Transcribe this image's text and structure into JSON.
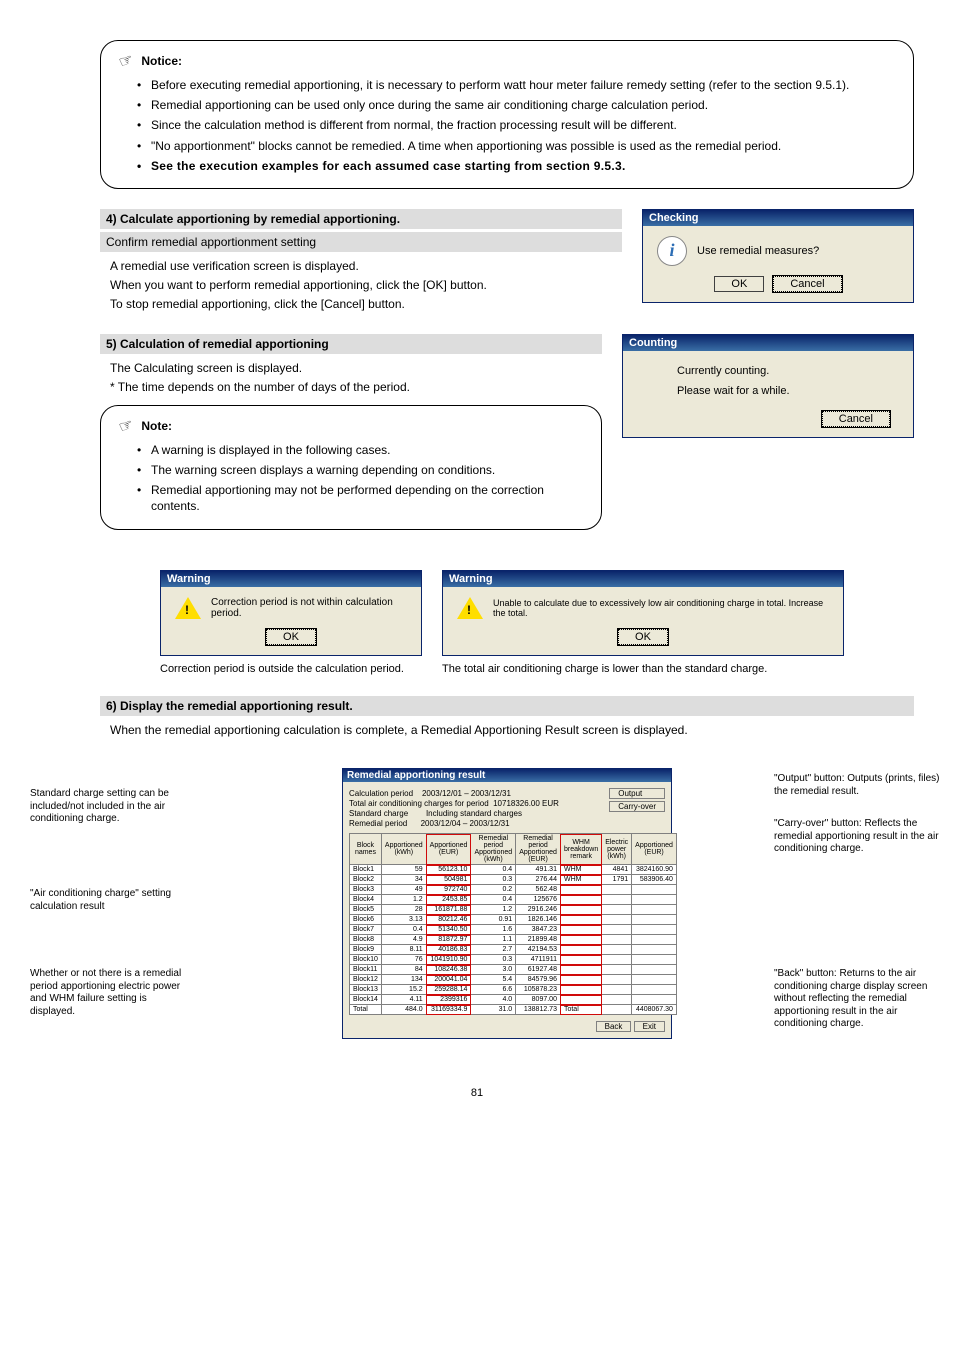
{
  "page_number": "81",
  "notice": {
    "heading": "Notice:",
    "bullets": [
      "Before executing remedial apportioning, it is necessary to perform watt hour meter failure remedy setting (refer to the section 9.5.1).",
      "Remedial apportioning can be used only once during the same air conditioning charge calculation period.",
      "Since the calculation method is different from normal, the fraction processing result will be different.",
      "\"No apportionment\" blocks cannot be remedied. A time when apportioning was possible is used as the remedial period."
    ],
    "bold_line": "See the execution examples for each assumed case starting from section 9.5.3."
  },
  "step4": {
    "header": "4) Calculate apportioning by remedial apportioning.",
    "sub": "Confirm remedial apportionment setting",
    "body": [
      "A remedial use verification screen is displayed.",
      "When you want to perform remedial apportioning, click the [OK] button.",
      "To stop remedial apportioning, click the [Cancel] button."
    ],
    "dlg": {
      "title": "Checking",
      "msg": "Use remedial measures?",
      "ok": "OK",
      "cancel": "Cancel"
    }
  },
  "step5": {
    "header": "5) Calculation of remedial apportioning",
    "body": [
      "The Calculating screen is displayed.",
      "* The time depends on the number of days of the period."
    ],
    "note_heading": "Note:",
    "note_bullets": [
      "A warning is displayed in the following cases.",
      "The warning screen displays a warning depending on conditions.",
      "Remedial apportioning may not be performed depending on the correction contents."
    ],
    "dlg": {
      "title": "Counting",
      "line1": "Currently counting.",
      "line2": "Please wait for a while.",
      "cancel": "Cancel"
    }
  },
  "warnings": {
    "w1": {
      "title": "Warning",
      "msg": "Correction period is not within calculation period.",
      "ok": "OK",
      "cap": "Correction period is outside the calculation period."
    },
    "w2": {
      "title": "Warning",
      "msg": "Unable to calculate due to excessively low air conditioning charge in total. Increase the total.",
      "ok": "OK",
      "cap": "The total air conditioning charge is lower than the standard charge."
    }
  },
  "step6": {
    "header": "6) Display the remedial apportioning result.",
    "body": "When the remedial apportioning calculation is complete, a Remedial Apportioning Result screen is displayed.",
    "annotations": {
      "a1": "Standard charge setting can be included/not included in the air conditioning charge.",
      "a2": "\"Air conditioning charge\" setting calculation result",
      "a3": "Whether or not there is a remedial period apportioning electric power and WHM failure setting is displayed.",
      "a4": "\"Output\" button: Outputs (prints, files) the remedial result.",
      "a5": "\"Carry-over\" button: Reflects the remedial apportioning result in the air conditioning charge.",
      "a6": "\"Back\" button: Returns to the air conditioning charge display screen without reflecting the remedial apportioning result in the air conditioning charge."
    }
  },
  "result_dlg": {
    "title": "Remedial apportioning result",
    "meta": {
      "calc_period_lbl": "Calculation period",
      "calc_period_val": "2003/12/01 – 2003/12/31",
      "total_lbl": "Total air conditioning charges for period",
      "total_val": "10718326.00 EUR",
      "std_lbl": "Standard charge",
      "std_val": "Including standard charges",
      "rem_lbl": "Remedial period",
      "rem_val": "2003/12/04 – 2003/12/31"
    },
    "buttons": {
      "output": "Output",
      "carryover": "Carry-over",
      "back": "Back",
      "exit": "Exit"
    },
    "headers": {
      "block": "Block names",
      "app_kwh": "Apportioned (kWh)",
      "app_eur": "Apportioned (EUR)",
      "rem_kwh": "Remedial period Apportioned (kWh)",
      "rem_eur": "Remedial period Apportioned (EUR)",
      "whm": "WHM breakdown remark",
      "elec_kwh": "Electric power (kWh)",
      "elec_eur": "Apportioned (EUR)"
    },
    "rows": [
      {
        "name": "Block1",
        "a": "59",
        "b": "56123.10",
        "c": "0.4",
        "d": "491.31",
        "whm": "WHM",
        "e": "4841",
        "f": "3824160.90"
      },
      {
        "name": "Block2",
        "a": "34",
        "b": "504981",
        "c": "0.3",
        "d": "276.44",
        "whm": "WHM",
        "e": "1791",
        "f": "583906.40"
      },
      {
        "name": "Block3",
        "a": "49",
        "b": "972740",
        "c": "0.2",
        "d": "562.48",
        "whm": "",
        "e": "",
        "f": ""
      },
      {
        "name": "Block4",
        "a": "1.2",
        "b": "2453.85",
        "c": "0.4",
        "d": "125676",
        "whm": "",
        "e": "",
        "f": ""
      },
      {
        "name": "Block5",
        "a": "28",
        "b": "161871.88",
        "c": "1.2",
        "d": "2916.246",
        "whm": "",
        "e": "",
        "f": ""
      },
      {
        "name": "Block6",
        "a": "3.13",
        "b": "80212.46",
        "c": "0.91",
        "d": "1826.146",
        "whm": "",
        "e": "",
        "f": ""
      },
      {
        "name": "Block7",
        "a": "0.4",
        "b": "51340.50",
        "c": "1.6",
        "d": "3847.23",
        "whm": "",
        "e": "",
        "f": ""
      },
      {
        "name": "Block8",
        "a": "4.9",
        "b": "81872.97",
        "c": "1.1",
        "d": "21899.48",
        "whm": "",
        "e": "",
        "f": ""
      },
      {
        "name": "Block9",
        "a": "8.11",
        "b": "40186.83",
        "c": "2.7",
        "d": "42194.53",
        "whm": "",
        "e": "",
        "f": ""
      },
      {
        "name": "Block10",
        "a": "76",
        "b": "1041910.90",
        "c": "0.3",
        "d": "4711911",
        "whm": "",
        "e": "",
        "f": ""
      },
      {
        "name": "Block11",
        "a": "84",
        "b": "108246.38",
        "c": "3.0",
        "d": "61927.48",
        "whm": "",
        "e": "",
        "f": ""
      },
      {
        "name": "Block12",
        "a": "134",
        "b": "200041.04",
        "c": "5.4",
        "d": "84579.96",
        "whm": "",
        "e": "",
        "f": ""
      },
      {
        "name": "Block13",
        "a": "15.2",
        "b": "259288.14",
        "c": "6.6",
        "d": "105878.23",
        "whm": "",
        "e": "",
        "f": ""
      },
      {
        "name": "Block14",
        "a": "4.11",
        "b": "2399316",
        "c": "4.0",
        "d": "8097.00",
        "whm": "",
        "e": "",
        "f": ""
      }
    ],
    "total_row": {
      "label": "Total",
      "a": "484.0",
      "b": "31169334.9",
      "c": "31.0",
      "d": "138812.73",
      "label2": "Total",
      "f": "4408067.30"
    }
  },
  "chart_data": {
    "type": "table",
    "title": "Remedial apportioning result",
    "columns": [
      "Block names",
      "Apportioned (kWh)",
      "Apportioned (EUR)",
      "Remedial period Apportioned (kWh)",
      "Remedial period Apportioned (EUR)",
      "WHM breakdown remark",
      "Electric power (kWh)",
      "Apportioned (EUR)"
    ],
    "rows": [
      [
        "Block1",
        59,
        56123.1,
        0.4,
        491.31,
        "WHM",
        4841,
        3824160.9
      ],
      [
        "Block2",
        34,
        504981,
        0.3,
        276.44,
        "WHM",
        1791,
        583906.4
      ],
      [
        "Block3",
        49,
        972740,
        0.2,
        562.48,
        "",
        null,
        null
      ],
      [
        "Block4",
        1.2,
        2453.85,
        0.4,
        125676,
        "",
        null,
        null
      ],
      [
        "Block5",
        28,
        161871.88,
        1.2,
        2916.246,
        "",
        null,
        null
      ],
      [
        "Block6",
        3.13,
        80212.46,
        0.91,
        1826.146,
        "",
        null,
        null
      ],
      [
        "Block7",
        0.4,
        51340.5,
        1.6,
        3847.23,
        "",
        null,
        null
      ],
      [
        "Block8",
        4.9,
        81872.97,
        1.1,
        21899.48,
        "",
        null,
        null
      ],
      [
        "Block9",
        8.11,
        40186.83,
        2.7,
        42194.53,
        "",
        null,
        null
      ],
      [
        "Block10",
        76,
        1041910.9,
        0.3,
        4711911,
        "",
        null,
        null
      ],
      [
        "Block11",
        84,
        108246.38,
        3.0,
        61927.48,
        "",
        null,
        null
      ],
      [
        "Block12",
        134,
        200041.04,
        5.4,
        84579.96,
        "",
        null,
        null
      ],
      [
        "Block13",
        15.2,
        259288.14,
        6.6,
        105878.23,
        "",
        null,
        null
      ],
      [
        "Block14",
        4.11,
        2399316,
        4.0,
        8097.0,
        "",
        null,
        null
      ]
    ],
    "totals": {
      "Apportioned (kWh)": 484.0,
      "Apportioned (EUR)": 31169334.9,
      "Remedial period Apportioned (kWh)": 31.0,
      "Remedial period Apportioned (EUR)": 138812.73,
      "Electric Apportioned (EUR)": 4408067.3
    }
  }
}
